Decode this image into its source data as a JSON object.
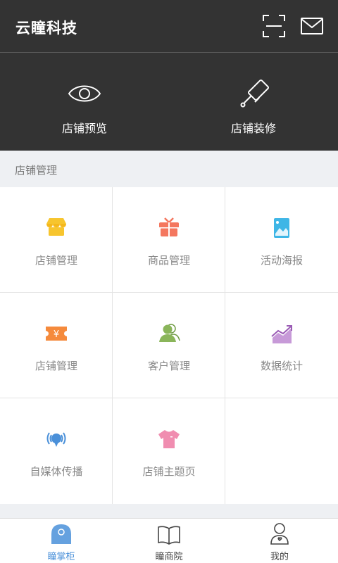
{
  "header": {
    "title": "云瞳科技",
    "actions": [
      {
        "icon": "scan-icon"
      },
      {
        "icon": "mail-icon"
      }
    ],
    "quick_actions": [
      {
        "label": "店铺预览",
        "icon": "eye-icon"
      },
      {
        "label": "店铺装修",
        "icon": "paint-roller-icon"
      }
    ]
  },
  "section": {
    "title": "店铺管理"
  },
  "grid": {
    "items": [
      {
        "label": "店铺管理",
        "icon": "store-icon",
        "color": "#f7c52e"
      },
      {
        "label": "商品管理",
        "icon": "gift-icon",
        "color": "#f4775f"
      },
      {
        "label": "活动海报",
        "icon": "poster-icon",
        "color": "#3fb6e6"
      },
      {
        "label": "店铺管理",
        "icon": "coupon-icon",
        "color": "#f58a3c"
      },
      {
        "label": "客户管理",
        "icon": "customers-icon",
        "color": "#8ab55a"
      },
      {
        "label": "数据统计",
        "icon": "chart-icon",
        "color": "#b07cc6"
      },
      {
        "label": "自媒体传播",
        "icon": "broadcast-icon",
        "color": "#4a90d9"
      },
      {
        "label": "店铺主题页",
        "icon": "tshirt-icon",
        "color": "#f08db0"
      }
    ]
  },
  "tabbar": {
    "tabs": [
      {
        "label": "瞳掌柜",
        "icon": "home-icon",
        "active": true
      },
      {
        "label": "瞳商院",
        "icon": "book-icon",
        "active": false
      },
      {
        "label": "我的",
        "icon": "user-icon",
        "active": false
      }
    ]
  },
  "colors": {
    "header_bg": "#333333",
    "accent": "#4a90d9",
    "page_bg": "#eef0f3"
  }
}
